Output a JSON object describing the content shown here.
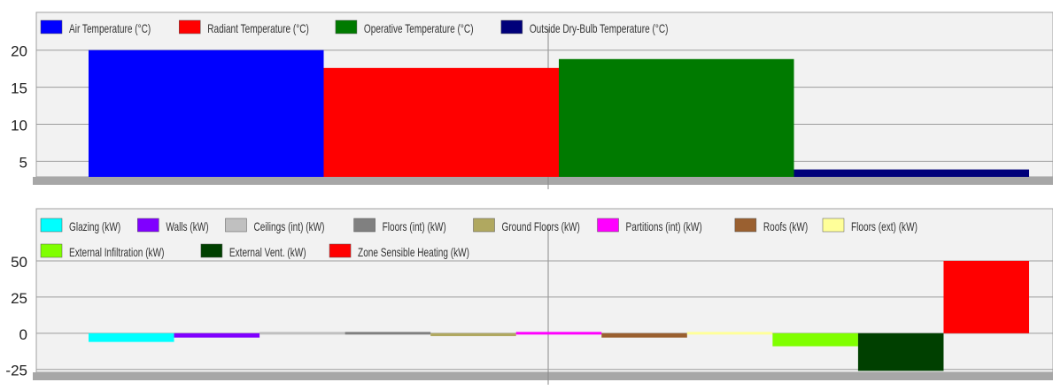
{
  "chart_data": [
    {
      "type": "bar",
      "categories": [
        "Air Temperature (°C)",
        "Radiant Temperature (°C)",
        "Operative Temperature (°C)",
        "Outside Dry-Bulb Temperature (°C)"
      ],
      "series": [
        {
          "name": "Air Temperature (°C)",
          "color": "#0000ff",
          "values": [
            20.0,
            null,
            null,
            null
          ]
        },
        {
          "name": "Radiant Temperature (°C)",
          "color": "#ff0000",
          "values": [
            null,
            17.6,
            null,
            null
          ]
        },
        {
          "name": "Operative Temperature (°C)",
          "color": "#007a00",
          "values": [
            null,
            null,
            18.8,
            null
          ]
        },
        {
          "name": "Outside Dry-Bulb Temperature (°C)",
          "color": "#00007a",
          "values": [
            null,
            null,
            null,
            3.9
          ]
        }
      ],
      "yticks": [
        5,
        10,
        15,
        20
      ],
      "ylim": [
        2.9,
        21.4
      ],
      "grid": true,
      "legend": "top"
    },
    {
      "type": "bar",
      "categories": [
        "Glazing (kW)",
        "Walls (kW)",
        "Ceilings (int) (kW)",
        "Floors (int) (kW)",
        "Ground Floors (kW)",
        "Partitions (int) (kW)",
        "Roofs (kW)",
        "Floors (ext) (kW)",
        "External Infiltration (kW)",
        "External Vent. (kW)",
        "Zone Sensible Heating (kW)"
      ],
      "series": [
        {
          "name": "Glazing (kW)",
          "color": "#00ffff",
          "values": [
            -6,
            null,
            null,
            null,
            null,
            null,
            null,
            null,
            null,
            null,
            null
          ]
        },
        {
          "name": "Walls (kW)",
          "color": "#8000ff",
          "values": [
            null,
            -3,
            null,
            null,
            null,
            null,
            null,
            null,
            null,
            null,
            null
          ]
        },
        {
          "name": "Ceilings (int) (kW)",
          "color": "#c0c0c0",
          "values": [
            null,
            null,
            0,
            null,
            null,
            null,
            null,
            null,
            null,
            null,
            null
          ]
        },
        {
          "name": "Floors (int) (kW)",
          "color": "#808080",
          "values": [
            null,
            null,
            null,
            -0.5,
            null,
            null,
            null,
            null,
            null,
            null,
            null
          ]
        },
        {
          "name": "Ground Floors (kW)",
          "color": "#b0a860",
          "values": [
            null,
            null,
            null,
            null,
            -2,
            null,
            null,
            null,
            null,
            null,
            null
          ]
        },
        {
          "name": "Partitions (int) (kW)",
          "color": "#ff00ff",
          "values": [
            null,
            null,
            null,
            null,
            null,
            0,
            null,
            null,
            null,
            null,
            null
          ]
        },
        {
          "name": "Roofs (kW)",
          "color": "#9a6030",
          "values": [
            null,
            null,
            null,
            null,
            null,
            null,
            -3,
            null,
            null,
            null,
            null
          ]
        },
        {
          "name": "Floors (ext) (kW)",
          "color": "#ffff99",
          "values": [
            null,
            null,
            null,
            null,
            null,
            null,
            null,
            -1,
            null,
            null,
            null
          ]
        },
        {
          "name": "External Infiltration (kW)",
          "color": "#80ff00",
          "values": [
            null,
            null,
            null,
            null,
            null,
            null,
            null,
            null,
            -9,
            null,
            null
          ]
        },
        {
          "name": "External Vent. (kW)",
          "color": "#004000",
          "values": [
            null,
            null,
            null,
            null,
            null,
            null,
            null,
            null,
            null,
            -26,
            null
          ]
        },
        {
          "name": "Zone Sensible Heating (kW)",
          "color": "#ff0000",
          "values": [
            null,
            null,
            null,
            null,
            null,
            null,
            null,
            null,
            null,
            null,
            50
          ]
        }
      ],
      "yticks": [
        -25,
        0,
        25,
        50
      ],
      "ylim": [
        -27,
        50
      ],
      "grid": true,
      "legend": "top"
    }
  ]
}
